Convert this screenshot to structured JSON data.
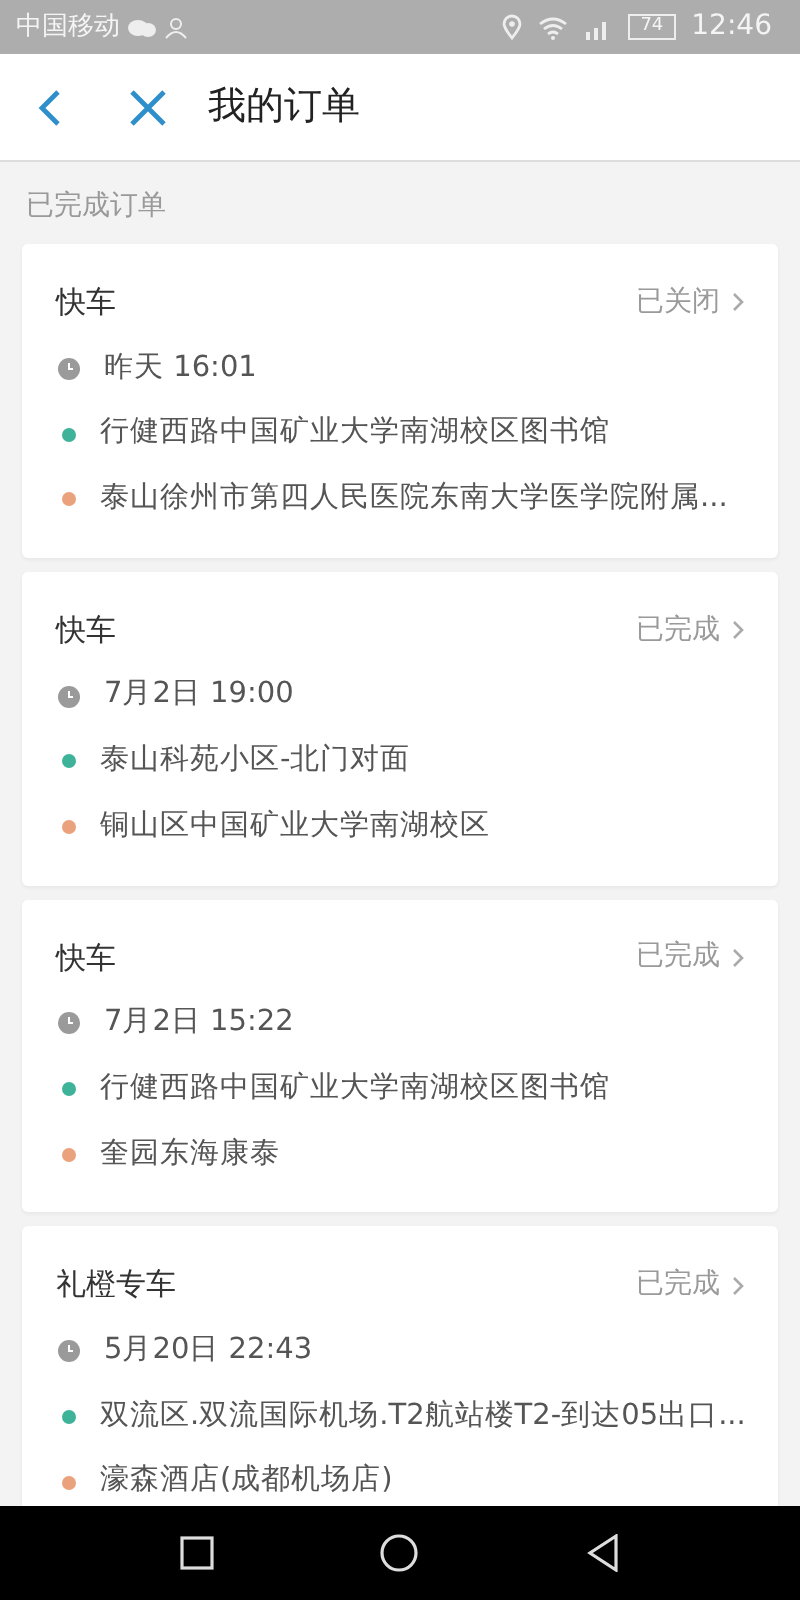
{
  "status_bar": {
    "carrier": "中国移动",
    "battery": "74",
    "time": "12:46"
  },
  "header": {
    "title": "我的订单"
  },
  "section_label": "已完成订单",
  "orders": [
    {
      "type": "快车",
      "status": "已关闭",
      "time": "昨天 16:01",
      "from": "行健西路中国矿业大学南湖校区图书馆",
      "to": "泰山徐州市第四人民医院东南大学医学院附属..."
    },
    {
      "type": "快车",
      "status": "已完成",
      "time": "7月2日 19:00",
      "from": "泰山科苑小区-北门对面",
      "to": "铜山区中国矿业大学南湖校区"
    },
    {
      "type": "快车",
      "status": "已完成",
      "time": "7月2日 15:22",
      "from": "行健西路中国矿业大学南湖校区图书馆",
      "to": "奎园东海康泰"
    },
    {
      "type": "礼橙专车",
      "status": "已完成",
      "time": "5月20日 22:43",
      "from": "双流区.双流国际机场.T2航站楼T2-到达05出口...",
      "to": "濠森酒店(成都机场店)"
    }
  ]
}
